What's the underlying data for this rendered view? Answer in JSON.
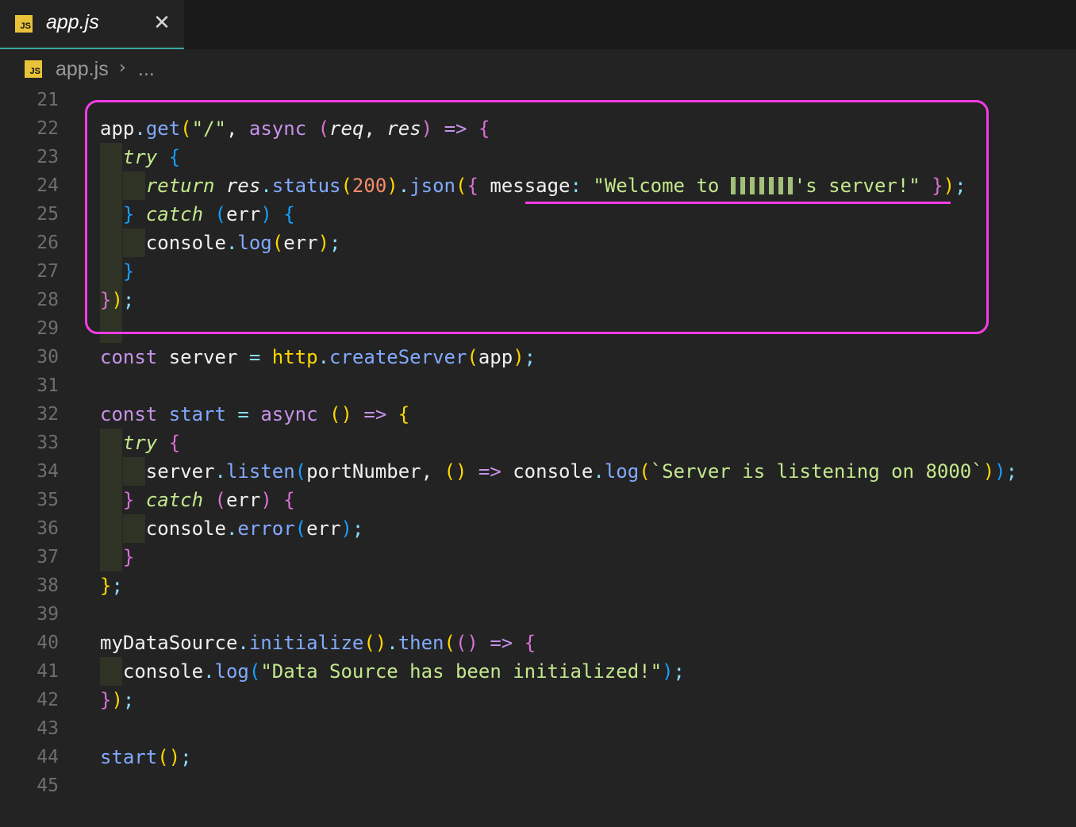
{
  "tab": {
    "title": "app.js",
    "icon": "js-file-icon",
    "close_glyph": "✕"
  },
  "breadcrumb": {
    "file": "app.js",
    "separator": "›",
    "more": "..."
  },
  "icon_badge": "JS",
  "colors": {
    "background": "#232323",
    "highlight": "#f53ce6",
    "keyword": "#c792ea",
    "function": "#82aaff",
    "string": "#c3e88d",
    "number": "#f78c6c"
  },
  "line_numbers": [
    "21",
    "22",
    "23",
    "24",
    "25",
    "26",
    "27",
    "28",
    "29",
    "30",
    "31",
    "32",
    "33",
    "34",
    "35",
    "36",
    "37",
    "38",
    "39",
    "40",
    "41",
    "42",
    "43",
    "44",
    "45"
  ],
  "code": {
    "l22": {
      "app": "app",
      "get": "get",
      "route": "\"/\"",
      "async": "async",
      "req": "req",
      "res": "res"
    },
    "l23": {
      "try": "try"
    },
    "l24": {
      "return": "return",
      "res": "res",
      "status": "status",
      "code": "200",
      "json": "json",
      "key": "message",
      "str_a": "\"Welcome to ",
      "str_b": "'s server!\""
    },
    "l25": {
      "catch": "catch",
      "err": "err"
    },
    "l26": {
      "console": "console",
      "log": "log",
      "err": "err"
    },
    "l30": {
      "const": "const",
      "server": "server",
      "http": "http",
      "create": "createServer",
      "app": "app"
    },
    "l32": {
      "const": "const",
      "start": "start",
      "async": "async"
    },
    "l33": {
      "try": "try"
    },
    "l34": {
      "server": "server",
      "listen": "listen",
      "port": "portNumber",
      "console": "console",
      "log": "log",
      "str": "`Server is listening on 8000`"
    },
    "l35": {
      "catch": "catch",
      "err": "err"
    },
    "l36": {
      "console": "console",
      "error": "error",
      "err": "err"
    },
    "l40": {
      "src": "myDataSource",
      "init": "initialize",
      "then": "then"
    },
    "l41": {
      "console": "console",
      "log": "log",
      "str": "\"Data Source has been initialized!\""
    },
    "l44": {
      "start": "start"
    }
  }
}
